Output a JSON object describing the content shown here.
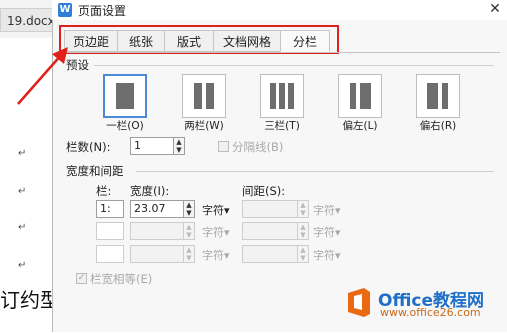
{
  "background_doc": {
    "tab_label": "19.docx",
    "paragraph_mark": "↵",
    "body_text": "订约型"
  },
  "dialog": {
    "title": "页面设置",
    "close_glyph": "✕",
    "app_icon_letter": "W",
    "tabs": [
      {
        "label": "页边距"
      },
      {
        "label": "纸张"
      },
      {
        "label": "版式"
      },
      {
        "label": "文档网格"
      },
      {
        "label": "分栏",
        "active": true
      }
    ],
    "presets_heading": "预设",
    "presets": [
      {
        "label": "一栏(O)",
        "selected": true
      },
      {
        "label": "两栏(W)"
      },
      {
        "label": "三栏(T)"
      },
      {
        "label": "偏左(L)"
      },
      {
        "label": "偏右(R)"
      }
    ],
    "columns_label": "栏数(N):",
    "columns_value": "1",
    "separator_label": "分隔线(B)",
    "width_spacing_heading": "宽度和间距",
    "col_header": "栏:",
    "width_header": "宽度(I):",
    "spacing_header": "间距(S):",
    "rows": [
      {
        "col": "1:",
        "width": "23.07",
        "unit": "字符▾",
        "spacing": "",
        "spacing_unit": "字符▾"
      },
      {
        "col": "",
        "width": "",
        "unit": "字符▾",
        "spacing": "",
        "spacing_unit": "字符▾"
      },
      {
        "col": "",
        "width": "",
        "unit": "字符▾",
        "spacing": "",
        "spacing_unit": "字符▾"
      }
    ],
    "equal_width_label": "栏宽相等(E)",
    "spin_up": "▲",
    "spin_down": "▼"
  },
  "watermark": {
    "title": "Office教程网",
    "url": "www.office26.com"
  },
  "colors": {
    "annotation_red": "#e0201a",
    "selected_border": "#4a8ad6",
    "watermark_blue": "#1f6fc9",
    "watermark_orange": "#ea6a13"
  },
  "icons": {
    "app": "wps-writer-icon",
    "close": "close-icon",
    "arrow": "red-annotation-arrow"
  }
}
